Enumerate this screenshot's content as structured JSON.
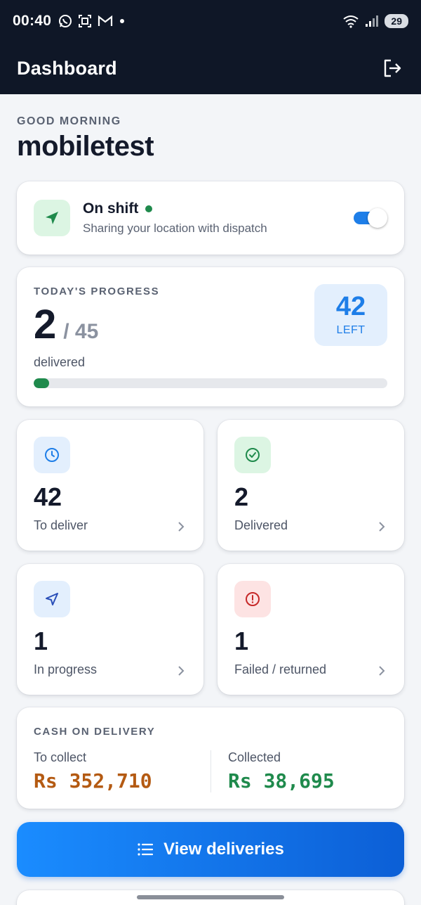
{
  "statusbar": {
    "time": "00:40",
    "battery": "29"
  },
  "appbar": {
    "title": "Dashboard"
  },
  "greeting": {
    "label": "GOOD MORNING",
    "username": "mobiletest"
  },
  "shift": {
    "title": "On shift",
    "subtitle": "Sharing your location with dispatch",
    "toggle_on": true
  },
  "progress": {
    "label": "TODAY'S PROGRESS",
    "delivered_count": "2",
    "total": "/ 45",
    "delivered_label": "delivered",
    "left_count": "42",
    "left_label": "LEFT",
    "fraction": 0.044
  },
  "stats": [
    {
      "value": "42",
      "label": "To deliver",
      "icon": "clock-icon",
      "color": "#1e7ee8",
      "bg": "#e3effd"
    },
    {
      "value": "2",
      "label": "Delivered",
      "icon": "check-circle-icon",
      "color": "#1f8a4c",
      "bg": "#dcf5e3"
    },
    {
      "value": "1",
      "label": "In progress",
      "icon": "navigation-icon",
      "color": "#2a4fb8",
      "bg": "#e3effd"
    },
    {
      "value": "1",
      "label": "Failed / returned",
      "icon": "alert-circle-icon",
      "color": "#c62828",
      "bg": "#fde3e3"
    }
  ],
  "cod": {
    "label": "CASH ON DELIVERY",
    "to_collect_label": "To collect",
    "to_collect_amount": "Rs 352,710",
    "collected_label": "Collected",
    "collected_amount": "Rs 38,695"
  },
  "view_button": {
    "label": "View deliveries"
  },
  "colors": {
    "header": "#0f1727",
    "accent": "#1e7ee8",
    "success": "#1f8a4c",
    "warning": "#b45a12",
    "danger": "#c62828"
  }
}
